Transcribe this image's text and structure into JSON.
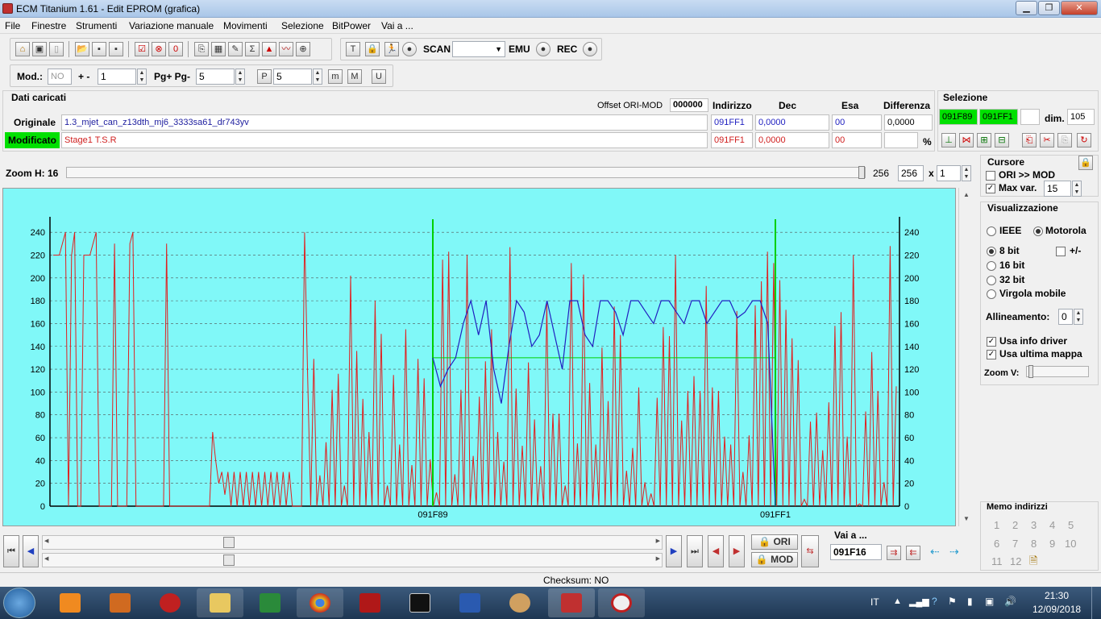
{
  "window": {
    "title": "ECM Titanium 1.61 - Edit EPROM (grafica)"
  },
  "menu": [
    "File",
    "Finestre",
    "Strumenti",
    "Variazione manuale",
    "Movimenti",
    "Selezione",
    "BitPower",
    "Vai a ..."
  ],
  "toolbar1": {
    "scan_label": "SCAN",
    "emu_label": "EMU",
    "rec_label": "REC"
  },
  "toolbar2": {
    "mod_label": "Mod.:",
    "mod_value": "NO",
    "plusminus_label": "+ -",
    "plusminus_value": "1",
    "pg_label": "Pg+ Pg-",
    "pg_value": "5",
    "p_value": "5"
  },
  "dati": {
    "title": "Dati caricati",
    "offset_label": "Offset ORI-MOD",
    "offset_value": "000000",
    "col_indirizzo": "Indirizzo",
    "col_dec": "Dec",
    "col_esa": "Esa",
    "col_differenza": "Differenza",
    "originale_label": "Originale",
    "originale_name": "1.3_mjet_can_z13dth_mj6_3333sa61_dr743yv",
    "originale_addr": "091FF1",
    "originale_dec": "0,0000",
    "originale_esa": "00",
    "originale_diff": "0,0000",
    "modificato_label": "Modificato",
    "modificato_name": "Stage1 T.S.R",
    "modificato_addr": "091FF1",
    "modificato_dec": "0,0000",
    "modificato_esa": "00",
    "percent": "%"
  },
  "selezione": {
    "title": "Selezione",
    "start": "091F89",
    "end": "091FF1",
    "dim_label": "dim.",
    "dim_value": "105"
  },
  "zoom": {
    "label": "Zoom H: 16",
    "value_text": "256",
    "field_value": "256",
    "x_label": "x",
    "mult": "1"
  },
  "cursore": {
    "title": "Cursore",
    "ori_mod": "ORI >> MOD",
    "max_var_label": "Max var.",
    "max_var_value": "15"
  },
  "visualizzazione": {
    "title": "Visualizzazione",
    "ieee": "IEEE",
    "motorola": "Motorola",
    "bit8": "8 bit",
    "bit16": "16 bit",
    "bit32": "32 bit",
    "virgola": "Virgola mobile",
    "plusminus": "+/-",
    "allineamento_label": "Allineamento:",
    "allineamento_value": "0",
    "usa_info": "Usa info driver",
    "usa_ultima": "Usa ultima mappa",
    "zoomv": "Zoom V:"
  },
  "nav": {
    "ori": "ORI",
    "mod": "MOD",
    "vai_label": "Vai a ...",
    "vai_value": "091F16"
  },
  "memo": {
    "title": "Memo indirizzi",
    "items": [
      "1",
      "2",
      "3",
      "4",
      "5",
      "6",
      "7",
      "8",
      "9",
      "10",
      "11",
      "12"
    ]
  },
  "status": {
    "checksum": "Checksum: NO"
  },
  "taskbar": {
    "lang": "IT",
    "time": "21:30",
    "date": "12/09/2018"
  },
  "colors": {
    "chart_bg": "#80f8f8",
    "series_ori": "#2020c0",
    "series_mod": "#e02020",
    "marker": "#00d000"
  },
  "chart_data": {
    "type": "line",
    "ylim": [
      0,
      250
    ],
    "yticks": [
      "0",
      "20",
      "40",
      "60",
      "80",
      "100",
      "120",
      "140",
      "160",
      "180",
      "200",
      "220",
      "240"
    ],
    "xlabels": [
      "091F89",
      "091FF1"
    ],
    "selection_marker_y": 130,
    "series": [
      {
        "values": [
          220,
          220,
          220,
          230,
          240,
          0,
          220,
          240,
          0,
          0,
          220,
          220,
          220,
          230,
          240,
          0,
          0,
          0,
          0,
          0,
          230,
          0,
          0,
          0,
          0,
          230,
          240,
          0,
          0,
          0,
          0,
          0,
          0,
          0,
          0,
          0,
          0,
          230,
          0,
          0,
          0,
          0,
          0,
          0,
          0,
          0,
          0,
          0,
          0,
          0,
          0,
          0,
          65,
          40,
          20,
          30,
          10,
          30,
          0,
          30,
          0,
          30,
          0,
          30,
          0,
          30,
          0,
          30,
          0,
          30,
          0,
          30,
          0,
          30,
          0,
          30,
          0,
          30,
          0,
          0,
          0,
          0,
          240,
          0,
          0,
          0,
          0,
          0,
          0,
          0,
          0,
          0,
          0,
          0,
          0,
          0,
          0,
          0,
          0,
          0,
          0,
          0,
          0,
          0,
          0,
          0,
          0,
          0,
          0,
          0,
          0,
          0,
          0,
          0,
          0,
          0,
          0,
          0,
          0,
          0,
          0,
          0,
          0,
          0,
          0,
          0,
          0,
          0,
          0,
          0,
          0,
          0,
          0,
          0,
          0,
          0,
          0,
          0,
          0,
          0,
          0,
          0,
          0,
          0,
          0,
          0,
          0,
          0,
          0,
          0,
          0,
          0,
          0,
          0,
          0,
          0,
          0,
          0,
          0,
          0,
          0,
          0,
          0,
          0,
          0,
          0,
          0,
          0,
          0,
          0,
          0,
          0,
          0,
          0,
          0,
          0,
          0,
          0,
          0,
          0,
          0,
          0,
          0,
          0,
          0,
          0,
          0,
          0,
          0,
          0,
          0,
          0,
          0,
          0,
          0,
          0,
          0,
          0,
          0,
          0,
          0,
          0,
          0,
          0,
          0,
          0,
          0,
          0,
          0,
          0,
          0,
          0,
          0,
          0,
          0,
          0,
          0,
          0,
          0,
          0,
          0,
          0,
          0,
          0,
          0,
          0,
          0,
          0,
          0,
          0,
          0,
          0,
          0,
          0,
          0,
          0,
          0,
          0,
          0,
          0,
          0,
          0,
          0,
          0,
          0,
          0,
          0,
          0,
          0,
          0,
          0,
          0,
          0,
          0,
          0,
          0,
          0,
          0,
          0,
          0,
          0,
          0,
          0,
          0,
          0,
          0,
          0,
          0,
          0,
          0,
          0,
          0,
          0,
          0,
          0,
          0
        ]
      },
      {
        "values": [
          130,
          105,
          120,
          130,
          160,
          180,
          150,
          180,
          120,
          90,
          140,
          180,
          170,
          140,
          150,
          180,
          150,
          120,
          180,
          180,
          150,
          140,
          180,
          180,
          170,
          150,
          180,
          180,
          170,
          160,
          180,
          180,
          170,
          160,
          180,
          180,
          160,
          170,
          180,
          180,
          165,
          170,
          180,
          180,
          160,
          0
        ]
      }
    ]
  }
}
